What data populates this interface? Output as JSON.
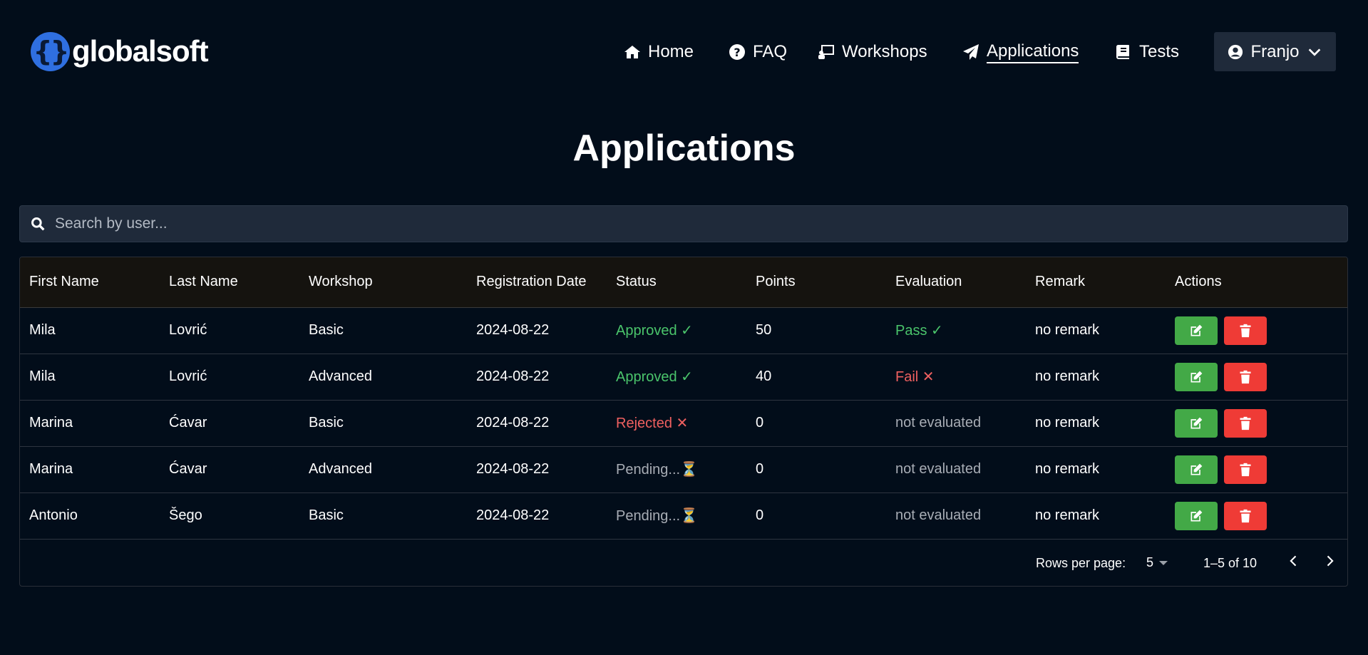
{
  "brand": {
    "name": "globalsoft",
    "mark": "{}"
  },
  "nav": {
    "home": "Home",
    "faq": "FAQ",
    "workshops": "Workshops",
    "applications": "Applications",
    "tests": "Tests",
    "user": "Franjo"
  },
  "page_title": "Applications",
  "search": {
    "placeholder": "Search by user..."
  },
  "table": {
    "headers": {
      "first_name": "First Name",
      "last_name": "Last Name",
      "workshop": "Workshop",
      "registration_date": "Registration Date",
      "status": "Status",
      "points": "Points",
      "evaluation": "Evaluation",
      "remark": "Remark",
      "actions": "Actions"
    },
    "rows": [
      {
        "first_name": "Mila",
        "last_name": "Lovrić",
        "workshop": "Basic",
        "date": "2024-08-22",
        "status": "Approved ✓",
        "points": "50",
        "evaluation": "Pass ✓",
        "remark": "no remark"
      },
      {
        "first_name": "Mila",
        "last_name": "Lovrić",
        "workshop": "Advanced",
        "date": "2024-08-22",
        "status": "Approved ✓",
        "points": "40",
        "evaluation": "Fail ✕",
        "remark": "no remark"
      },
      {
        "first_name": "Marina",
        "last_name": "Ćavar",
        "workshop": "Basic",
        "date": "2024-08-22",
        "status": "Rejected ✕",
        "points": "0",
        "evaluation": "not evaluated",
        "remark": "no remark"
      },
      {
        "first_name": "Marina",
        "last_name": "Ćavar",
        "workshop": "Advanced",
        "date": "2024-08-22",
        "status": "Pending...⏳",
        "points": "0",
        "evaluation": "not evaluated",
        "remark": "no remark"
      },
      {
        "first_name": "Antonio",
        "last_name": "Šego",
        "workshop": "Basic",
        "date": "2024-08-22",
        "status": "Pending...⏳",
        "points": "0",
        "evaluation": "not evaluated",
        "remark": "no remark"
      }
    ]
  },
  "pagination": {
    "rows_per_page_label": "Rows per page:",
    "rows_per_page": "5",
    "range": "1–5 of 10"
  },
  "colors": {
    "background": "#020d1a",
    "approved": "#4ac46b",
    "rejected": "#ef6060",
    "edit_button": "#43a947",
    "delete_button": "#ef3b36"
  }
}
